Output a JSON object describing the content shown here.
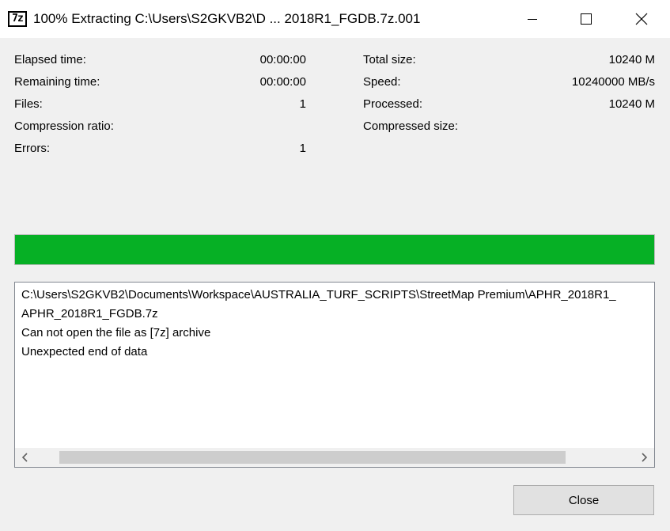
{
  "window": {
    "app_icon_text": "7z",
    "title": "100% Extracting C:\\Users\\S2GKVB2\\D ... 2018R1_FGDB.7z.001"
  },
  "stats_left": [
    {
      "label": "Elapsed time:",
      "value": "00:00:00"
    },
    {
      "label": "Remaining time:",
      "value": "00:00:00"
    },
    {
      "label": "Files:",
      "value": "1"
    },
    {
      "label": "Compression ratio:",
      "value": ""
    },
    {
      "label": "Errors:",
      "value": "1"
    }
  ],
  "stats_right": [
    {
      "label": "Total size:",
      "value": "10240 M"
    },
    {
      "label": "Speed:",
      "value": "10240000 MB/s"
    },
    {
      "label": "Processed:",
      "value": "10240 M"
    },
    {
      "label": "Compressed size:",
      "value": ""
    }
  ],
  "progress": {
    "percent": 100,
    "color": "#06b025"
  },
  "log": {
    "lines": [
      "C:\\Users\\S2GKVB2\\Documents\\Workspace\\AUSTRALIA_TURF_SCRIPTS\\StreetMap Premium\\APHR_2018R1_",
      "APHR_2018R1_FGDB.7z",
      "Can not open the file as [7z] archive",
      "Unexpected end of data"
    ]
  },
  "buttons": {
    "close_label": "Close"
  },
  "icons": {
    "minimize": "minimize-icon",
    "maximize": "maximize-icon",
    "close": "close-icon",
    "scroll_left": "chevron-left-icon",
    "scroll_right": "chevron-right-icon"
  }
}
